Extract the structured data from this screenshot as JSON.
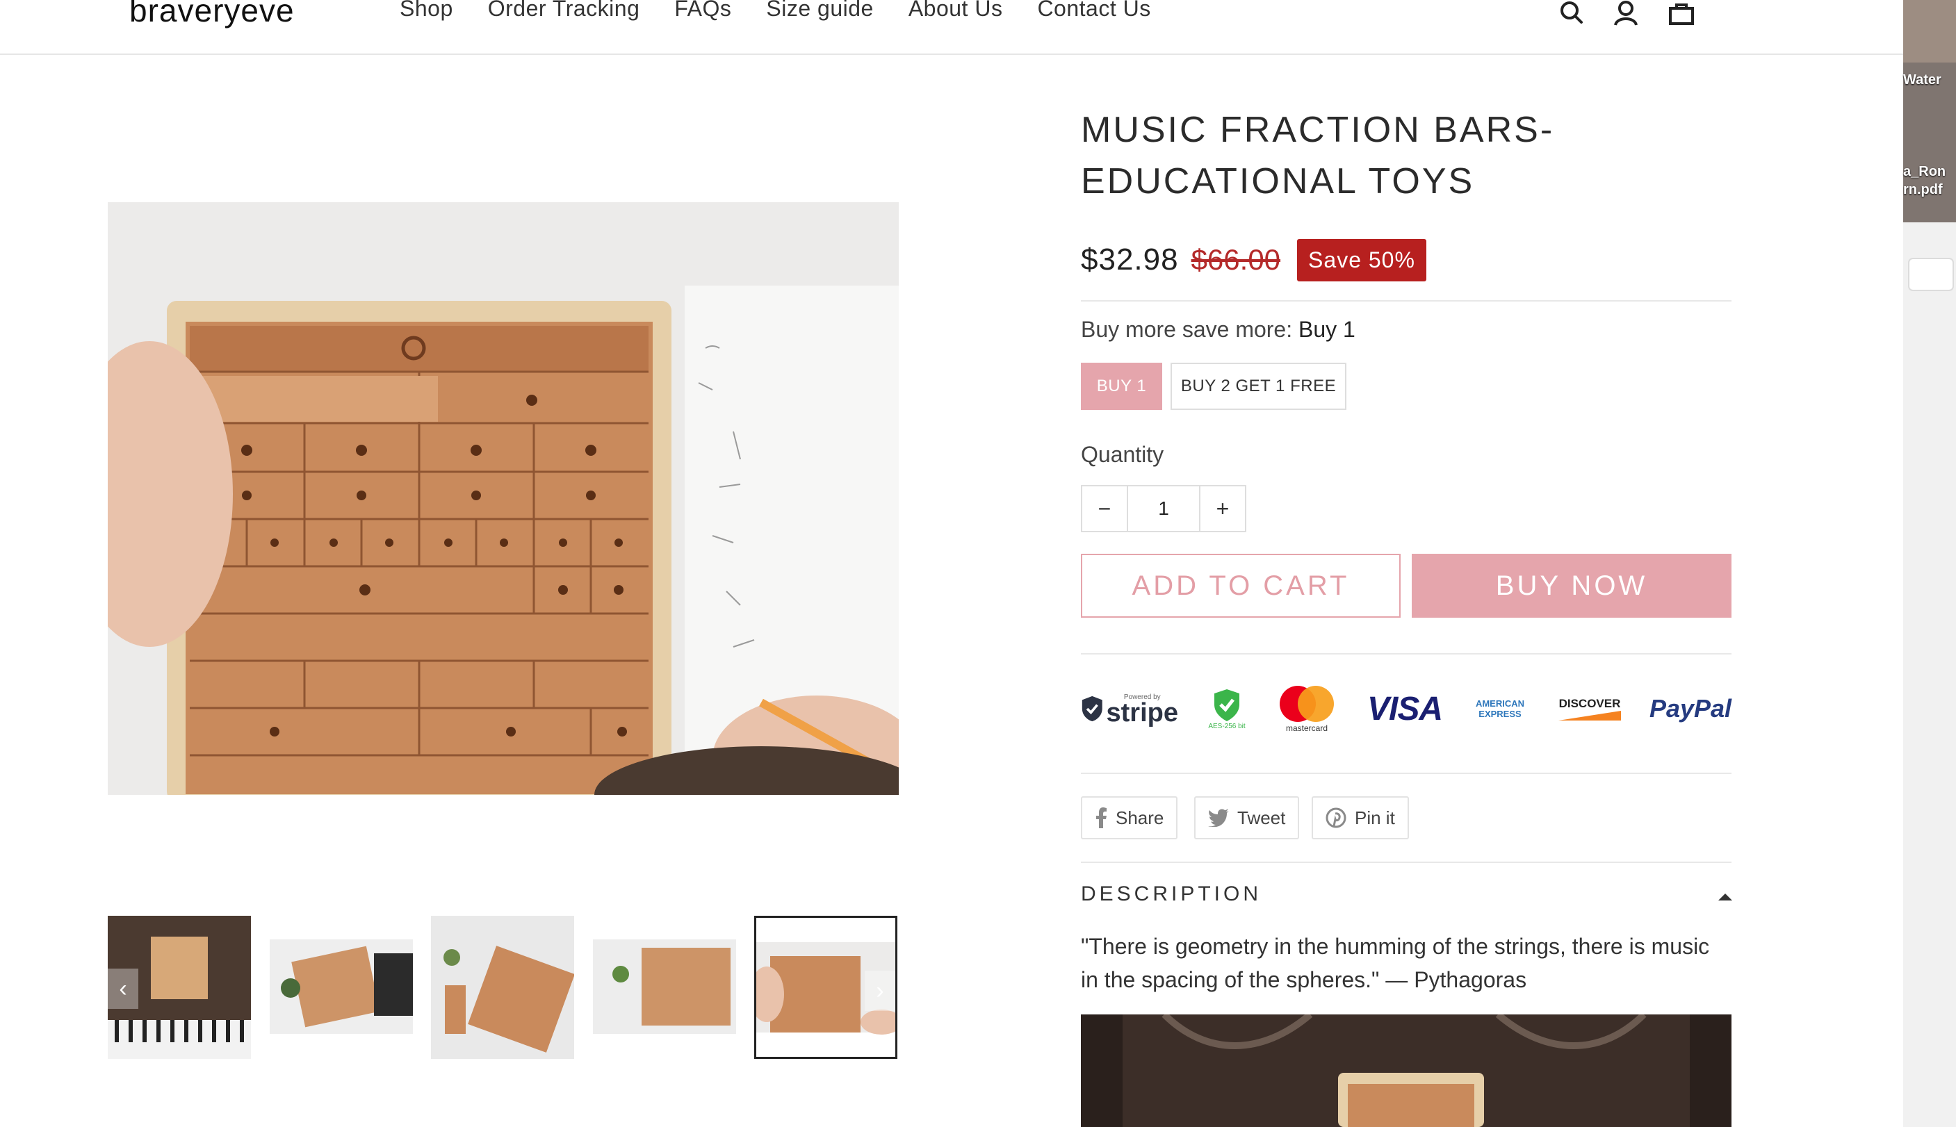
{
  "header": {
    "logo": "braveryeve",
    "nav": [
      "Shop",
      "Order Tracking",
      "FAQs",
      "Size guide",
      "About Us",
      "Contact Us"
    ],
    "icons": [
      "search-icon",
      "account-icon",
      "cart-icon"
    ]
  },
  "gallery": {
    "thumbnails": 5,
    "active_thumbnail": 5,
    "prev_arrow": "‹",
    "next_arrow": "›"
  },
  "product": {
    "title": "MUSIC FRACTION BARS- EDUCATIONAL TOYS",
    "price": "$32.98",
    "compare_price": "$66.00",
    "save_badge": "Save 50%",
    "buy_more_label": "Buy more save more:",
    "buy_more_value": "Buy 1",
    "options": [
      "BUY 1",
      "BUY 2 GET 1 FREE"
    ],
    "selected_option": "BUY 1",
    "quantity_label": "Quantity",
    "quantity_value": "1",
    "qty_minus": "−",
    "qty_plus": "+",
    "add_to_cart": "ADD TO CART",
    "buy_now": "BUY NOW"
  },
  "payments": {
    "stripe_small": "Powered by",
    "stripe": "stripe",
    "aes": "AES-256 bit",
    "mastercard": "mastercard",
    "visa": "VISA",
    "amex_1": "AMERICAN",
    "amex_2": "EXPRESS",
    "discover": "DISCOVER",
    "paypal": "PayPal"
  },
  "share": {
    "facebook": "Share",
    "twitter": "Tweet",
    "pinterest": "Pin it"
  },
  "description": {
    "heading": "DESCRIPTION",
    "quote": "\"There is geometry in the humming of the strings, there is music in the spacing of the spheres.\" — Pythagoras"
  },
  "desktop": {
    "file_1": "Water",
    "file_2a": "a_Ron",
    "file_2b": "rn.pdf"
  },
  "colors": {
    "accent_pink": "#e5a5ac",
    "sale_red": "#b7201f",
    "compare_red": "#b42a2a"
  }
}
